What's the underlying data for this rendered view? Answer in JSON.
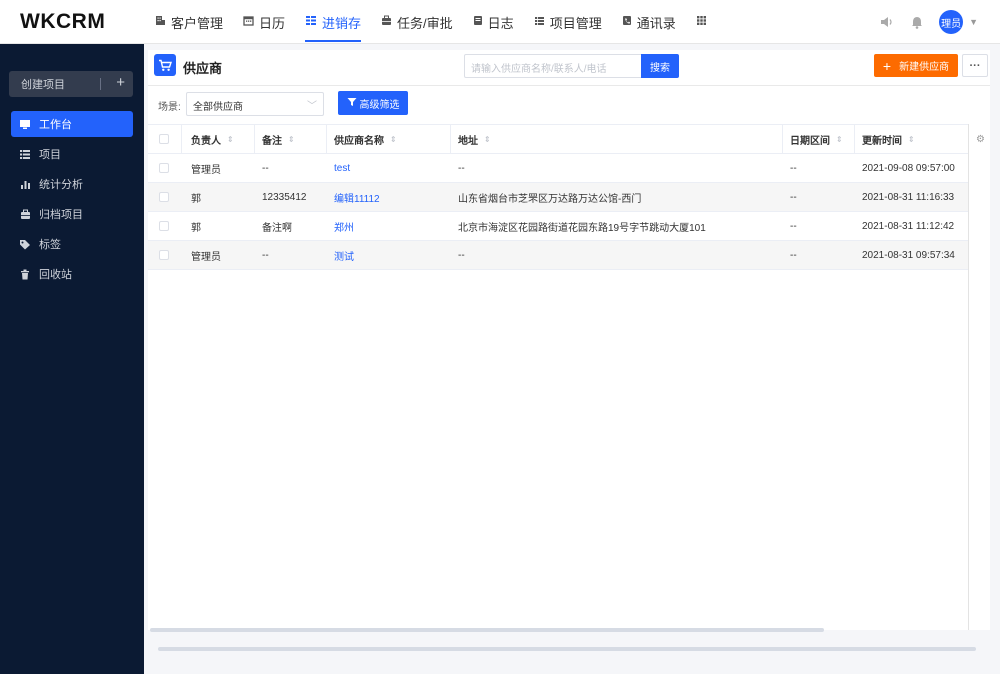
{
  "app": {
    "logo": "WKCRM"
  },
  "nav": {
    "items": [
      {
        "label": "客户管理",
        "icon": "building-icon",
        "active": false
      },
      {
        "label": "日历",
        "icon": "calendar-icon",
        "active": false
      },
      {
        "label": "进销存",
        "icon": "inventory-icon",
        "active": true
      },
      {
        "label": "任务/审批",
        "icon": "briefcase-icon",
        "active": false
      },
      {
        "label": "日志",
        "icon": "log-icon",
        "active": false
      },
      {
        "label": "项目管理",
        "icon": "project-icon",
        "active": false
      },
      {
        "label": "通讯录",
        "icon": "contacts-icon",
        "active": false
      }
    ],
    "apps_icon": "grid-icon"
  },
  "user": {
    "avatar_text": "理员"
  },
  "sidebar": {
    "create_label": "创建项目",
    "items": [
      {
        "label": "工作台",
        "icon": "monitor-icon",
        "active": true
      },
      {
        "label": "项目",
        "icon": "list-icon",
        "active": false
      },
      {
        "label": "统计分析",
        "icon": "bar-chart-icon",
        "active": false
      },
      {
        "label": "归档项目",
        "icon": "archive-icon",
        "active": false
      },
      {
        "label": "标签",
        "icon": "tag-icon",
        "active": false
      },
      {
        "label": "回收站",
        "icon": "trash-icon",
        "active": false
      }
    ]
  },
  "page": {
    "title": "供应商",
    "search_placeholder": "请输入供应商名称/联系人/电话",
    "search_button": "搜索",
    "new_button": "新建供应商",
    "more_button": "···",
    "scene_label": "场景:",
    "scene_value": "全部供应商",
    "advanced_filter": "高级筛选"
  },
  "table": {
    "columns": [
      "负责人",
      "备注",
      "供应商名称",
      "地址",
      "日期区间",
      "更新时间"
    ],
    "rows": [
      {
        "owner": "管理员",
        "note": "--",
        "name": "test",
        "address": "--",
        "date_range": "--",
        "updated": "2021-09-08 09:57:00"
      },
      {
        "owner": "郭",
        "note": "12335412",
        "name": "编辑11112",
        "address": "山东省烟台市芝罘区万达路万达公馆-西门",
        "date_range": "--",
        "updated": "2021-08-31 11:16:33"
      },
      {
        "owner": "郭",
        "note": "备注啊",
        "name": "郑州",
        "address": "北京市海淀区花园路街道花园东路19号字节跳动大厦101",
        "date_range": "--",
        "updated": "2021-08-31 11:12:42"
      },
      {
        "owner": "管理员",
        "note": "--",
        "name": "测试",
        "address": "--",
        "date_range": "--",
        "updated": "2021-08-31 09:57:34"
      }
    ]
  },
  "colors": {
    "primary": "#2362fb",
    "accent": "#fd6b00",
    "sidebar_bg": "#0b1a33"
  }
}
